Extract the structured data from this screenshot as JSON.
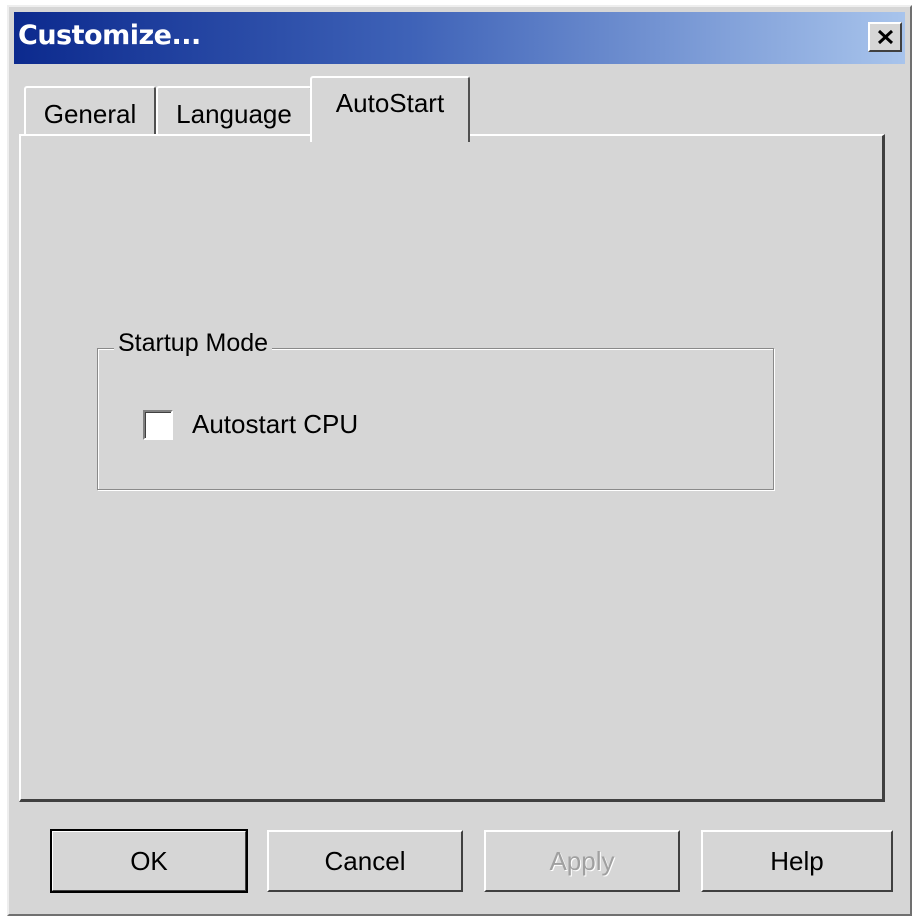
{
  "window": {
    "title": "Customize...",
    "close_symbol": "close-icon"
  },
  "tabs": [
    {
      "label": "General",
      "selected": false
    },
    {
      "label": "Language",
      "selected": false
    },
    {
      "label": "AutoStart",
      "selected": true
    }
  ],
  "startup_group": {
    "label": "Startup Mode",
    "checkbox_label": "Autostart CPU",
    "checked": false
  },
  "buttons": {
    "ok": "OK",
    "cancel": "Cancel",
    "apply": "Apply",
    "help": "Help"
  },
  "colors": {
    "title_start": "#0c2a8e",
    "title_end": "#a8c4ec",
    "face": "#d6d6d6"
  }
}
